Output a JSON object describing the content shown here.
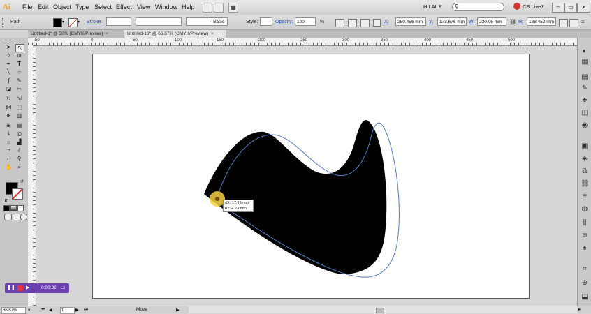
{
  "app": {
    "logo": "Ai",
    "brand_color": "#f39c1e"
  },
  "menubar": {
    "items": [
      "File",
      "Edit",
      "Object",
      "Type",
      "Select",
      "Effect",
      "View",
      "Window",
      "Help"
    ],
    "workspace": "HILAL",
    "cslive": "CS Live"
  },
  "controlbar": {
    "selection_type": "Path",
    "stroke_label": "Stroke:",
    "stroke_style": "Basic",
    "style_label": "Style:",
    "opacity_label": "Opacity:",
    "opacity_value": "100",
    "opacity_unit": "%",
    "x_label": "X:",
    "x_value": "250.456 mm",
    "y_label": "Y:",
    "y_value": "173.676 mm",
    "w_label": "W:",
    "w_value": "230.06 mm",
    "h_label": "H:",
    "h_value": "188.452 mm"
  },
  "tabs": [
    {
      "label": "Untitled-1* @ 50% (CMYK/Preview)",
      "close": "×"
    },
    {
      "label": "Untitled-16* @ 66.67% (CMYK/Preview)",
      "close": "×"
    }
  ],
  "ruler": {
    "labels": [
      "50",
      "0",
      "50",
      "100",
      "150",
      "200",
      "250",
      "300",
      "350",
      "400",
      "450",
      "500"
    ]
  },
  "tooltip": {
    "dx": "dX: 17.99 mm",
    "dy": "dY: 4.23 mm"
  },
  "recorder": {
    "time": "0:00:32"
  },
  "statusbar": {
    "zoom": "66.67%",
    "page": "1",
    "tool": "Move"
  },
  "colors": {
    "fill": "#000000",
    "outline": "#5b78c6",
    "artboard": "#ffffff",
    "highlight": "#f4d23a"
  }
}
